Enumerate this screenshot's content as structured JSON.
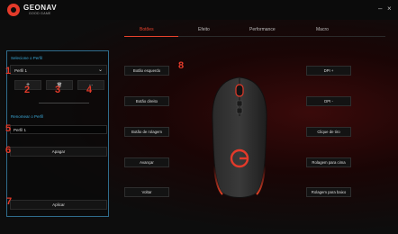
{
  "app": {
    "brand": "GEONAV",
    "brand_sub": "GOOD GAME",
    "minimize": "–",
    "close": "×"
  },
  "tabs": [
    {
      "label": "Botões",
      "active": true
    },
    {
      "label": "Efeito",
      "active": false
    },
    {
      "label": "Performance",
      "active": false
    },
    {
      "label": "Macro",
      "active": false
    }
  ],
  "profile_panel": {
    "select_title": "Selecione o Perfil",
    "selected_profile": "Perfil 1",
    "add_icon": "+",
    "delete_icon": "🗑",
    "more_icon": "···",
    "rename_title": "Renomear o Perfil",
    "rename_value": "Perfil 1",
    "delete_label": "Apagar",
    "apply_label": "Aplicar"
  },
  "numbers": [
    "1",
    "2",
    "3",
    "4",
    "5",
    "6",
    "7",
    "8"
  ],
  "left_buttons": [
    "Botão esquerdo",
    "Botão direito",
    "Botão de rolagem",
    "Avançar",
    "Voltar"
  ],
  "right_buttons": [
    "DPI +",
    "DPI -",
    "Clique de tiro",
    "Rolagem para cima",
    "Rolagem para baixo"
  ],
  "colors": {
    "accent": "#e8412c",
    "panel_border": "#2f6c8c",
    "section_title": "#3aa7d6"
  }
}
